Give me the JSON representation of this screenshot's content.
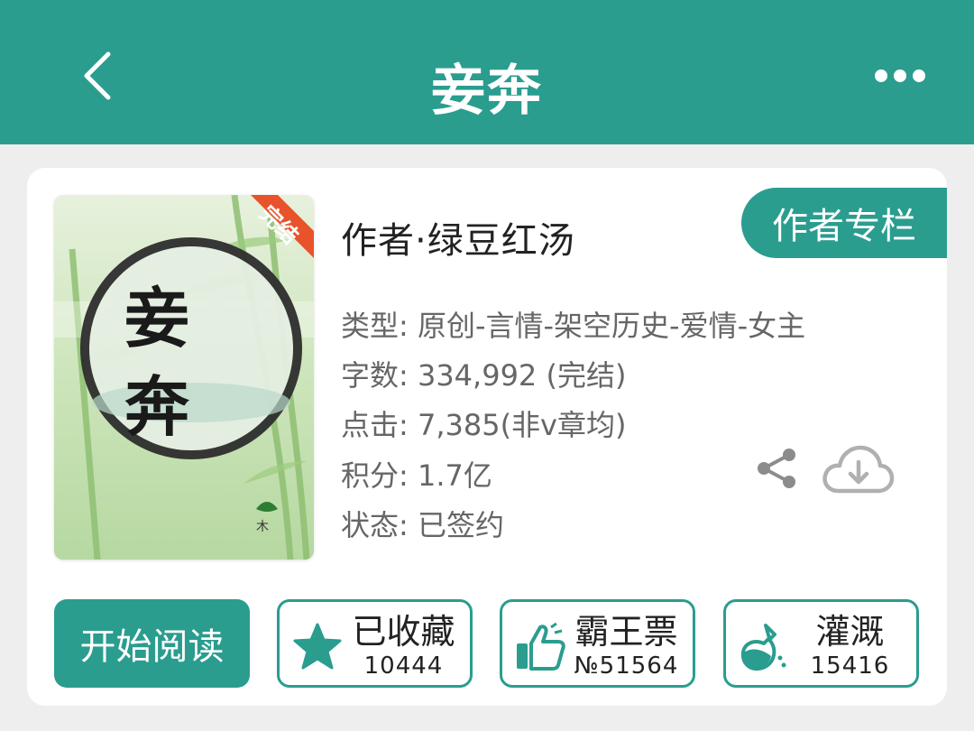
{
  "header": {
    "title": "妾奔",
    "back_icon": "chevron-left-icon",
    "more_icon": "more-horizontal-icon"
  },
  "book": {
    "cover": {
      "badge": "完结",
      "title_chars": [
        "妾",
        "奔"
      ]
    },
    "author_line": "作者·绿豆红汤",
    "author_column_label": "作者专栏",
    "meta": {
      "type": "类型: 原创-言情-架空历史-爱情-女主",
      "words": "字数: 334,992 (完结)",
      "clicks": "点击: 7,385(非v章均)",
      "score": "积分: 1.7亿",
      "status": "状态: 已签约"
    }
  },
  "actions": {
    "read_label": "开始阅读",
    "favorite": {
      "label": "已收藏",
      "count": "10444",
      "icon": "star-icon"
    },
    "vote": {
      "label": "霸王票",
      "count": "№51564",
      "icon": "thumbs-up-icon"
    },
    "water": {
      "label": "灌溉",
      "count": "15416",
      "icon": "flask-icon"
    },
    "share_icon": "share-icon",
    "download_icon": "cloud-download-icon"
  },
  "colors": {
    "accent": "#2a9d8f",
    "badge": "#e8532b",
    "page_bg": "#eeeeee"
  }
}
